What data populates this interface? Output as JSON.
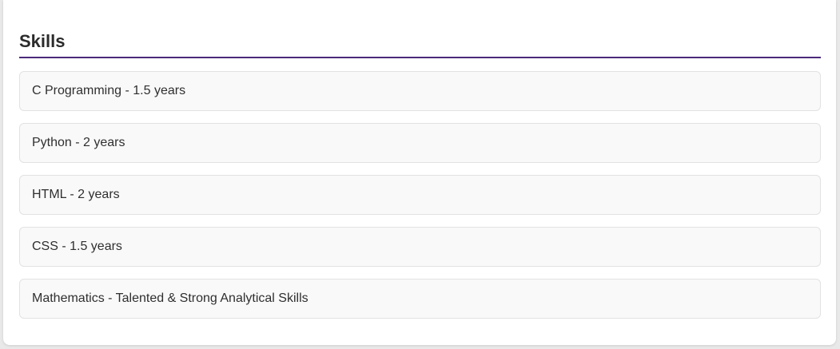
{
  "section": {
    "title": "Skills",
    "accent_color": "#4b2a7b"
  },
  "skills": [
    {
      "label": "C Programming - 1.5 years"
    },
    {
      "label": "Python - 2 years"
    },
    {
      "label": "HTML - 2 years"
    },
    {
      "label": "CSS - 1.5 years"
    },
    {
      "label": "Mathematics - Talented & Strong Analytical Skills"
    }
  ]
}
